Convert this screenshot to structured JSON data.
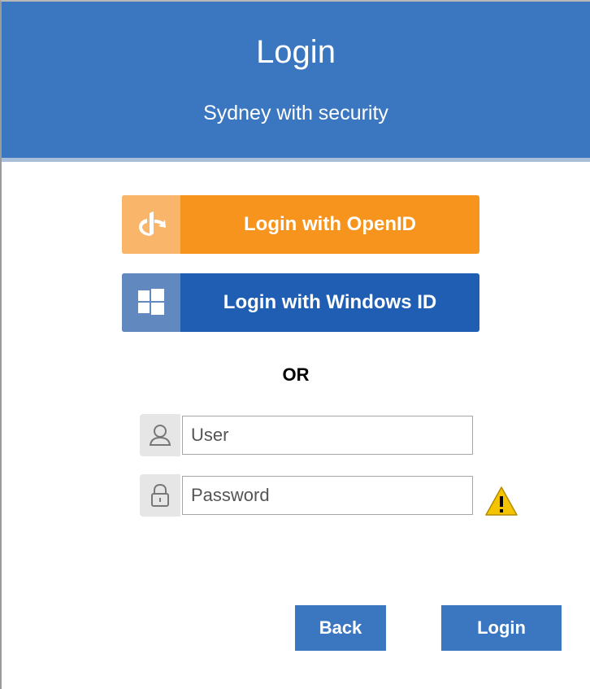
{
  "header": {
    "title": "Login",
    "subtitle": "Sydney with security"
  },
  "sso": {
    "openid": {
      "label": "Login with OpenID",
      "icon": "openid-icon"
    },
    "windows": {
      "label": "Login with Windows ID",
      "icon": "windows-icon"
    }
  },
  "separator": "OR",
  "form": {
    "user": {
      "placeholder": "User",
      "value": "",
      "icon": "user-icon"
    },
    "password": {
      "placeholder": "Password",
      "value": "",
      "icon": "lock-icon"
    },
    "warning_icon": "warning-icon"
  },
  "actions": {
    "back_label": "Back",
    "login_label": "Login"
  },
  "colors": {
    "header": "#3a77c0",
    "openid": "#f7941d",
    "windows": "#1f5eb3",
    "warning": "#f5c400"
  }
}
